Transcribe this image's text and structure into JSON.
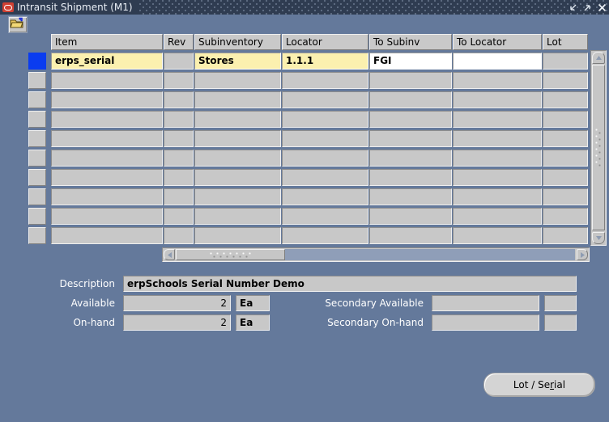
{
  "window": {
    "title": "Intransit Shipment (M1)",
    "icon": "oracle-window-icon",
    "controls": {
      "minimize": "minimize",
      "maximize": "maximize",
      "close": "close"
    }
  },
  "toolbar": {
    "open_button_label": "open-folder"
  },
  "grid": {
    "columns": [
      {
        "key": "item",
        "label": "Item"
      },
      {
        "key": "rev",
        "label": "Rev"
      },
      {
        "key": "subinv",
        "label": "Subinventory"
      },
      {
        "key": "locator",
        "label": "Locator"
      },
      {
        "key": "to_subinv",
        "label": "To Subinv"
      },
      {
        "key": "to_locator",
        "label": "To Locator"
      },
      {
        "key": "lot",
        "label": "Lot"
      }
    ],
    "rows": [
      {
        "selected": true,
        "item": "erps_serial",
        "rev": "",
        "subinv": "Stores",
        "locator": "1.1.1",
        "to_subinv": "FGI",
        "to_locator": "",
        "lot": ""
      },
      {
        "selected": false,
        "item": "",
        "rev": "",
        "subinv": "",
        "locator": "",
        "to_subinv": "",
        "to_locator": "",
        "lot": ""
      },
      {
        "selected": false,
        "item": "",
        "rev": "",
        "subinv": "",
        "locator": "",
        "to_subinv": "",
        "to_locator": "",
        "lot": ""
      },
      {
        "selected": false,
        "item": "",
        "rev": "",
        "subinv": "",
        "locator": "",
        "to_subinv": "",
        "to_locator": "",
        "lot": ""
      },
      {
        "selected": false,
        "item": "",
        "rev": "",
        "subinv": "",
        "locator": "",
        "to_subinv": "",
        "to_locator": "",
        "lot": ""
      },
      {
        "selected": false,
        "item": "",
        "rev": "",
        "subinv": "",
        "locator": "",
        "to_subinv": "",
        "to_locator": "",
        "lot": ""
      },
      {
        "selected": false,
        "item": "",
        "rev": "",
        "subinv": "",
        "locator": "",
        "to_subinv": "",
        "to_locator": "",
        "lot": ""
      },
      {
        "selected": false,
        "item": "",
        "rev": "",
        "subinv": "",
        "locator": "",
        "to_subinv": "",
        "to_locator": "",
        "lot": ""
      },
      {
        "selected": false,
        "item": "",
        "rev": "",
        "subinv": "",
        "locator": "",
        "to_subinv": "",
        "to_locator": "",
        "lot": ""
      },
      {
        "selected": false,
        "item": "",
        "rev": "",
        "subinv": "",
        "locator": "",
        "to_subinv": "",
        "to_locator": "",
        "lot": ""
      }
    ]
  },
  "details": {
    "description_label": "Description",
    "description_value": "erpSchools Serial Number Demo",
    "available_label": "Available",
    "available_value": "2",
    "available_uom": "Ea",
    "onhand_label": "On-hand",
    "onhand_value": "2",
    "onhand_uom": "Ea",
    "secondary_available_label": "Secondary Available",
    "secondary_available_value": "",
    "secondary_available_uom": "",
    "secondary_onhand_label": "Secondary On-hand",
    "secondary_onhand_value": "",
    "secondary_onhand_uom": ""
  },
  "actions": {
    "lot_serial_pre": "Lot / Se",
    "lot_serial_mnemonic": "r",
    "lot_serial_post": "ial"
  },
  "colors": {
    "window_bg": "#64799b",
    "titlebar": "#2f3c51",
    "field_bg": "#c8c8c8",
    "active_field": "#fbf0af",
    "selection": "#0a3cf0"
  }
}
